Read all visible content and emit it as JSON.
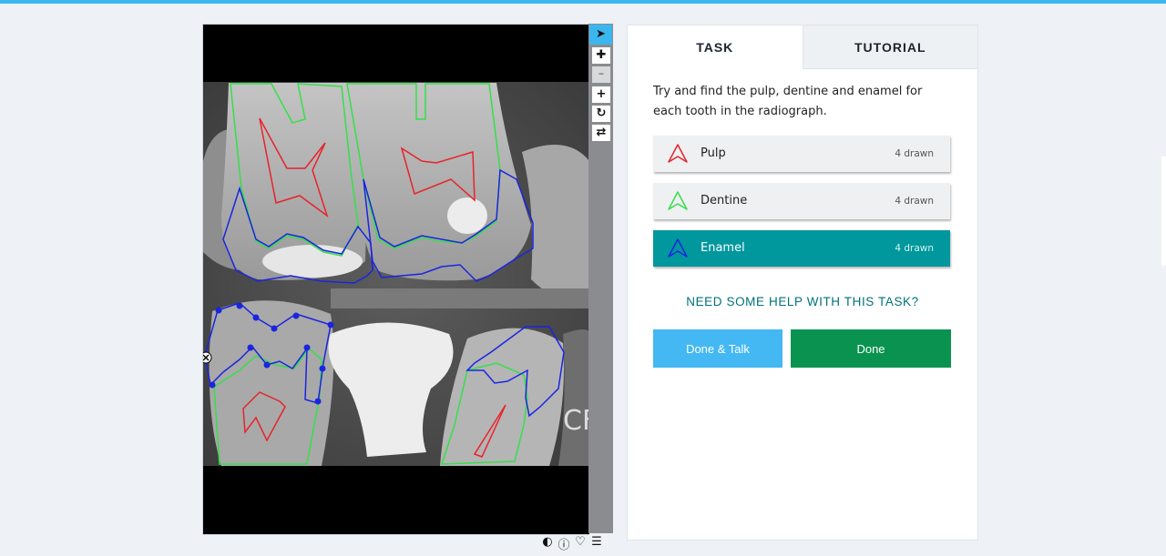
{
  "tabs": [
    {
      "label": "TASK",
      "active": true
    },
    {
      "label": "TUTORIAL",
      "active": false
    }
  ],
  "instructions": "Try and find the pulp, dentine and enamel for each tooth in the radiograph.",
  "tools": [
    {
      "label": "Pulp",
      "count": "4 drawn",
      "color": "#e8232a",
      "selected": false
    },
    {
      "label": "Dentine",
      "count": "4 drawn",
      "color": "#34e04a",
      "selected": false
    },
    {
      "label": "Enamel",
      "count": "4 drawn",
      "color": "#1a25e0",
      "selected": true
    }
  ],
  "help_link": "NEED SOME HELP WITH THIS TASK?",
  "buttons": {
    "done_talk": "Done & Talk",
    "done": "Done"
  },
  "viewer_tools": [
    "pointer-icon",
    "move-icon",
    "zoom-out-icon",
    "zoom-in-icon",
    "rotate-icon",
    "reset-icon"
  ],
  "viewer_footer_icons": [
    "invert-icon",
    "info-icon",
    "favorite-icon",
    "collections-icon"
  ],
  "watermark": "CF",
  "colors": {
    "accent": "#3bb7f0",
    "selected_tool": "#00979d",
    "done": "#0a9350",
    "done_talk": "#43b8f2"
  }
}
